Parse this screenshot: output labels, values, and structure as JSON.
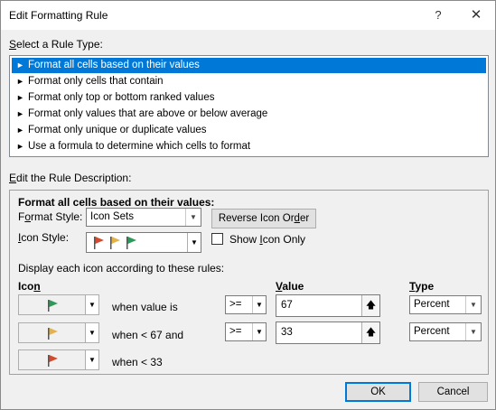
{
  "window": {
    "title": "Edit Formatting Rule",
    "help": "?",
    "close": "✕"
  },
  "rule_type": {
    "label_accel": "S",
    "label_rest": "elect a Rule Type:",
    "items": [
      {
        "text": "Format all cells based on their values",
        "selected": true
      },
      {
        "text": "Format only cells that contain",
        "selected": false
      },
      {
        "text": "Format only top or bottom ranked values",
        "selected": false
      },
      {
        "text": "Format only values that are above or below average",
        "selected": false
      },
      {
        "text": "Format only unique or duplicate values",
        "selected": false
      },
      {
        "text": "Use a formula to determine which cells to format",
        "selected": false
      }
    ]
  },
  "description": {
    "label_accel": "E",
    "label_rest": "dit the Rule Description:",
    "heading": "Format all cells based on their values:",
    "format_style_label_pre": "F",
    "format_style_label_accel": "o",
    "format_style_label_post": "rmat Style:",
    "format_style_value": "Icon Sets",
    "reverse_button_pre": "Reverse Icon Or",
    "reverse_button_accel": "d",
    "reverse_button_post": "er",
    "icon_style_label_accel": "I",
    "icon_style_label_rest": "con Style:",
    "show_icon_only_pre": "Show ",
    "show_icon_only_accel": "I",
    "show_icon_only_post": "con Only",
    "show_icon_only_checked": false,
    "rules_intro": "Display each icon according to these rules:",
    "col_icon_pre": "Ico",
    "col_icon_accel": "n",
    "col_value_accel": "V",
    "col_value_rest": "alue",
    "col_type_accel": "T",
    "col_type_rest": "ype",
    "rows": [
      {
        "icon": "green-flag-icon",
        "color": "#2e9a5a",
        "condition": "when value is",
        "operator": ">=",
        "value": "67",
        "type": "Percent"
      },
      {
        "icon": "yellow-flag-icon",
        "color": "#e3b24a",
        "condition": "when < 67 and",
        "operator": ">=",
        "value": "33",
        "type": "Percent"
      },
      {
        "icon": "red-flag-icon",
        "color": "#d24b2e",
        "condition": "when < 33"
      }
    ]
  },
  "buttons": {
    "ok": "OK",
    "cancel": "Cancel"
  },
  "colors": {
    "selection": "#0078d7",
    "flag_green": "#2e9a5a",
    "flag_yellow": "#e3b24a",
    "flag_red": "#d24b2e"
  },
  "icons": {
    "arrow": "▼",
    "up": "🡅",
    "tri": "►"
  }
}
